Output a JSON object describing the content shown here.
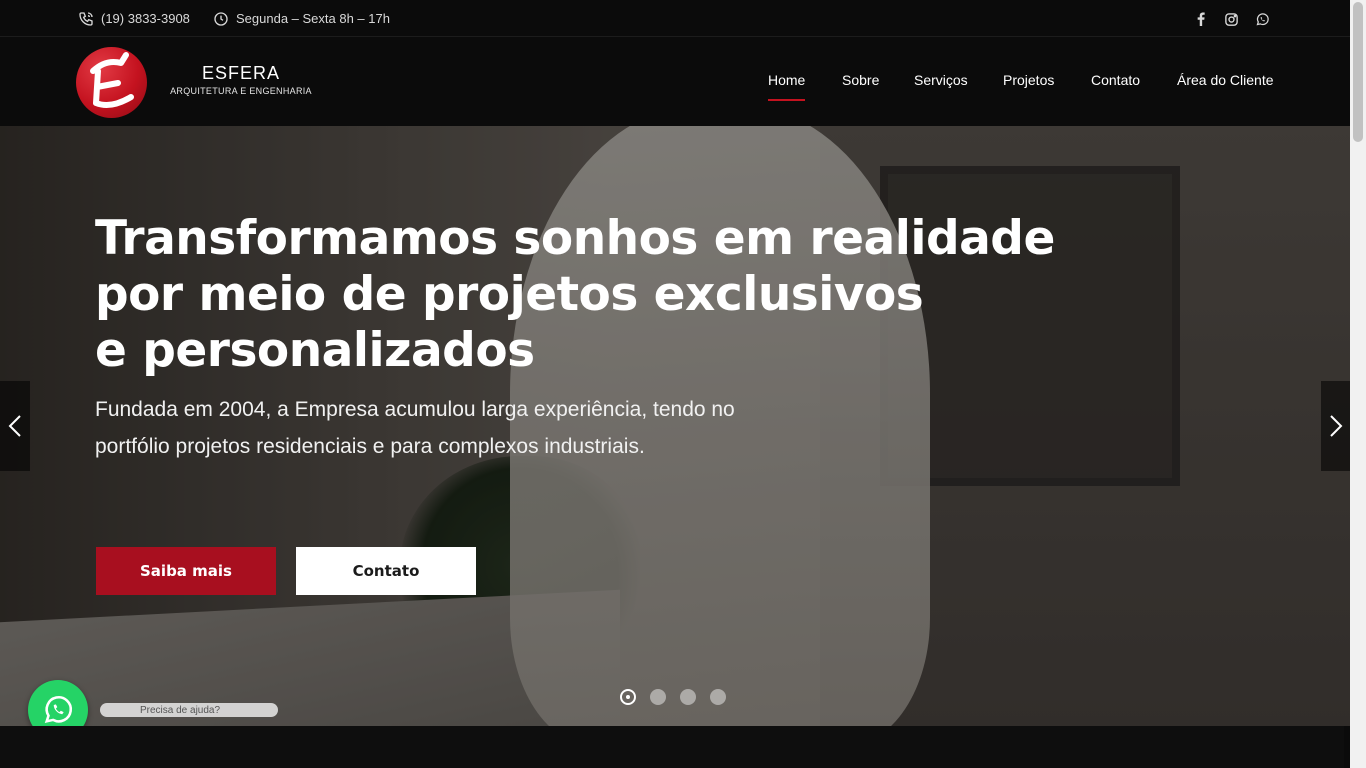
{
  "topbar": {
    "phone": "(19) 3833-3908",
    "hours": "Segunda – Sexta 8h – 17h",
    "social": [
      "facebook-icon",
      "instagram-icon",
      "whatsapp-icon"
    ]
  },
  "brand": {
    "title": "ESFERA",
    "subtitle": "ARQUITETURA E ENGENHARIA",
    "color": "#c4121f"
  },
  "nav": {
    "items": [
      "Home",
      "Sobre",
      "Serviços",
      "Projetos",
      "Contato",
      "Área do Cliente"
    ],
    "active": "Home"
  },
  "hero": {
    "title_lines": [
      "Transformamos sonhos em realidade",
      "por meio de projetos exclusivos",
      "e personalizados"
    ],
    "desc_lines": [
      "Fundada em 2004, a Empresa acumulou larga experiência, tendo no",
      "portfólio projetos residenciais e para complexos industriais."
    ],
    "primary_button": "Saiba mais",
    "secondary_button": "Contato",
    "slides_total": 4,
    "slide_active": 1,
    "help_text": "Precisa de ajuda?"
  },
  "colors": {
    "accent": "#a80f1f",
    "whatsapp": "#25d366",
    "background": "#0b0b0b"
  }
}
